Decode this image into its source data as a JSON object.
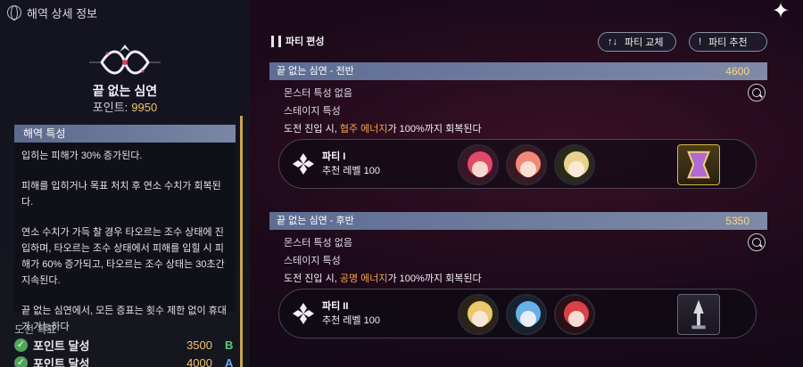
{
  "header": {
    "title": "해역 상세 정보"
  },
  "location": {
    "name": "끝 없는 심연",
    "points_label": "포인트:",
    "points_value": "9950"
  },
  "trait": {
    "title": "해역 특성",
    "paragraphs": [
      "입히는 피해가 30% 증가된다.",
      "피해를 입히거나 목표 처치 후 연소 수치가 회복된다.",
      "연소 수치가 가득 찰 경우 타오르는 조수 상태에 진입하며, 타오르는 조수 상태에서 피해를 입힐 시 피해가 60% 증가되고, 타오르는 조수 상태는 30초간 지속된다.",
      "끝 없는 심연에서, 모든 증표는 횟수 제한 없이 휴대가 가능하다"
    ]
  },
  "goals": {
    "label": "도전 목표",
    "items": [
      {
        "text": "포인트 달성",
        "value": "3500",
        "grade": "B"
      },
      {
        "text": "포인트 달성",
        "value": "4000",
        "grade": "A"
      }
    ]
  },
  "party_section": {
    "title": "파티 편성",
    "swap_label": "파티 교체",
    "swap_icon": "↑↓",
    "recommend_label": "파티 추천",
    "recommend_icon": "!"
  },
  "stages": [
    {
      "name": "끝 없는 심연 - 전반",
      "points": "4600",
      "monster_trait": "몬스터 특성 없음",
      "stage_trait": "스테이지 특성",
      "effect_prefix": "도전 진입 시, ",
      "effect_highlight": "협주 에너지",
      "effect_suffix": "가 100%까지 회복된다",
      "party_name": "파티 I",
      "party_level": "추천 레벨 100",
      "avatars": [
        "#e04a6a",
        "#f08a78",
        "#e8d28a"
      ],
      "relic_color": "#d8b84a"
    },
    {
      "name": "끝 없는 심연 - 후반",
      "points": "5350",
      "monster_trait": "몬스터 특성 없음",
      "stage_trait": "스테이지 특성",
      "effect_prefix": "도전 진입 시, ",
      "effect_highlight": "공명 에너지",
      "effect_suffix": "가 100%까지 회복된다",
      "party_name": "파티 II",
      "party_level": "추천 레벨 100",
      "avatars": [
        "#e8c86a",
        "#6ab0e8",
        "#d8404a"
      ],
      "relic_color": "#8a8a96"
    }
  ]
}
